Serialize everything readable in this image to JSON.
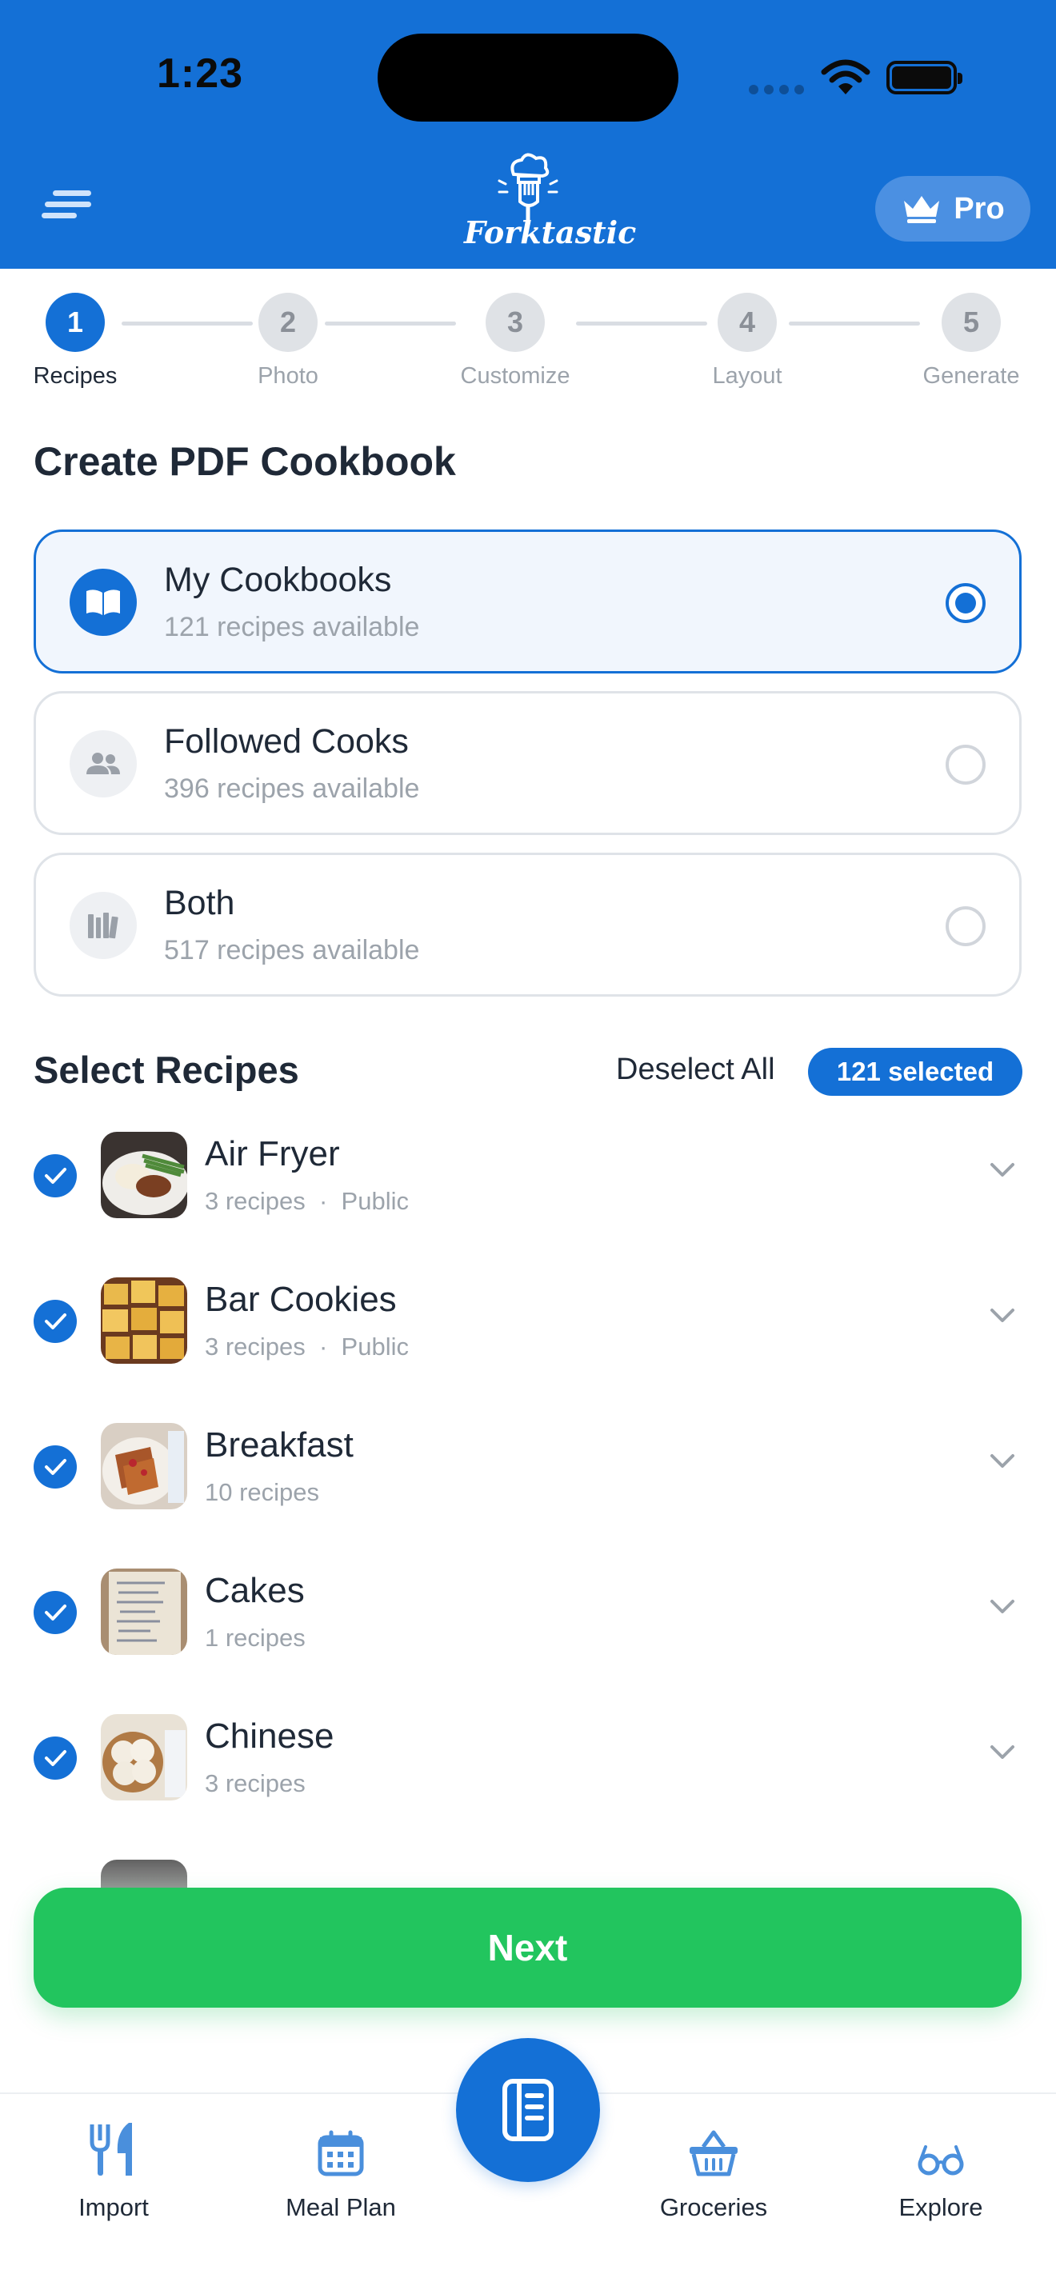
{
  "status_bar": {
    "time": "1:23"
  },
  "header": {
    "logo_text": "Forktastic",
    "pro_label": "Pro",
    "brand_color": "#1470d6"
  },
  "stepper": {
    "steps": [
      {
        "number": "1",
        "label": "Recipes",
        "active": true
      },
      {
        "number": "2",
        "label": "Photo",
        "active": false
      },
      {
        "number": "3",
        "label": "Customize",
        "active": false
      },
      {
        "number": "4",
        "label": "Layout",
        "active": false
      },
      {
        "number": "5",
        "label": "Generate",
        "active": false
      }
    ]
  },
  "page_title": "Create PDF Cookbook",
  "sources": [
    {
      "title": "My Cookbooks",
      "subtitle": "121 recipes available",
      "icon": "open-book-icon",
      "selected": true
    },
    {
      "title": "Followed Cooks",
      "subtitle": "396 recipes available",
      "icon": "people-icon",
      "selected": false
    },
    {
      "title": "Both",
      "subtitle": "517 recipes available",
      "icon": "library-icon",
      "selected": false
    }
  ],
  "select_recipes": {
    "title": "Select Recipes",
    "deselect_label": "Deselect All",
    "selected_count": "121 selected"
  },
  "recipes": [
    {
      "name": "Air Fryer",
      "meta": "3 recipes  ·  Public",
      "checked": true,
      "thumb": "plate-meat-potatoes"
    },
    {
      "name": "Bar Cookies",
      "meta": "3 recipes  ·  Public",
      "checked": true,
      "thumb": "lemon-bars"
    },
    {
      "name": "Breakfast",
      "meta": "10 recipes",
      "checked": true,
      "thumb": "french-toast"
    },
    {
      "name": "Cakes",
      "meta": "1 recipes",
      "checked": true,
      "thumb": "handwritten-recipe-card"
    },
    {
      "name": "Chinese",
      "meta": "3 recipes",
      "checked": true,
      "thumb": "steamed-buns"
    }
  ],
  "next_label": "Next",
  "next_color": "#22c55e",
  "tabbar": {
    "tabs": [
      {
        "label": "Import",
        "icon": "fork-knife-icon"
      },
      {
        "label": "Meal Plan",
        "icon": "calendar-icon"
      },
      {
        "label": "Groceries",
        "icon": "basket-icon"
      },
      {
        "label": "Explore",
        "icon": "glasses-icon"
      }
    ],
    "center_icon": "cookbook-icon"
  }
}
